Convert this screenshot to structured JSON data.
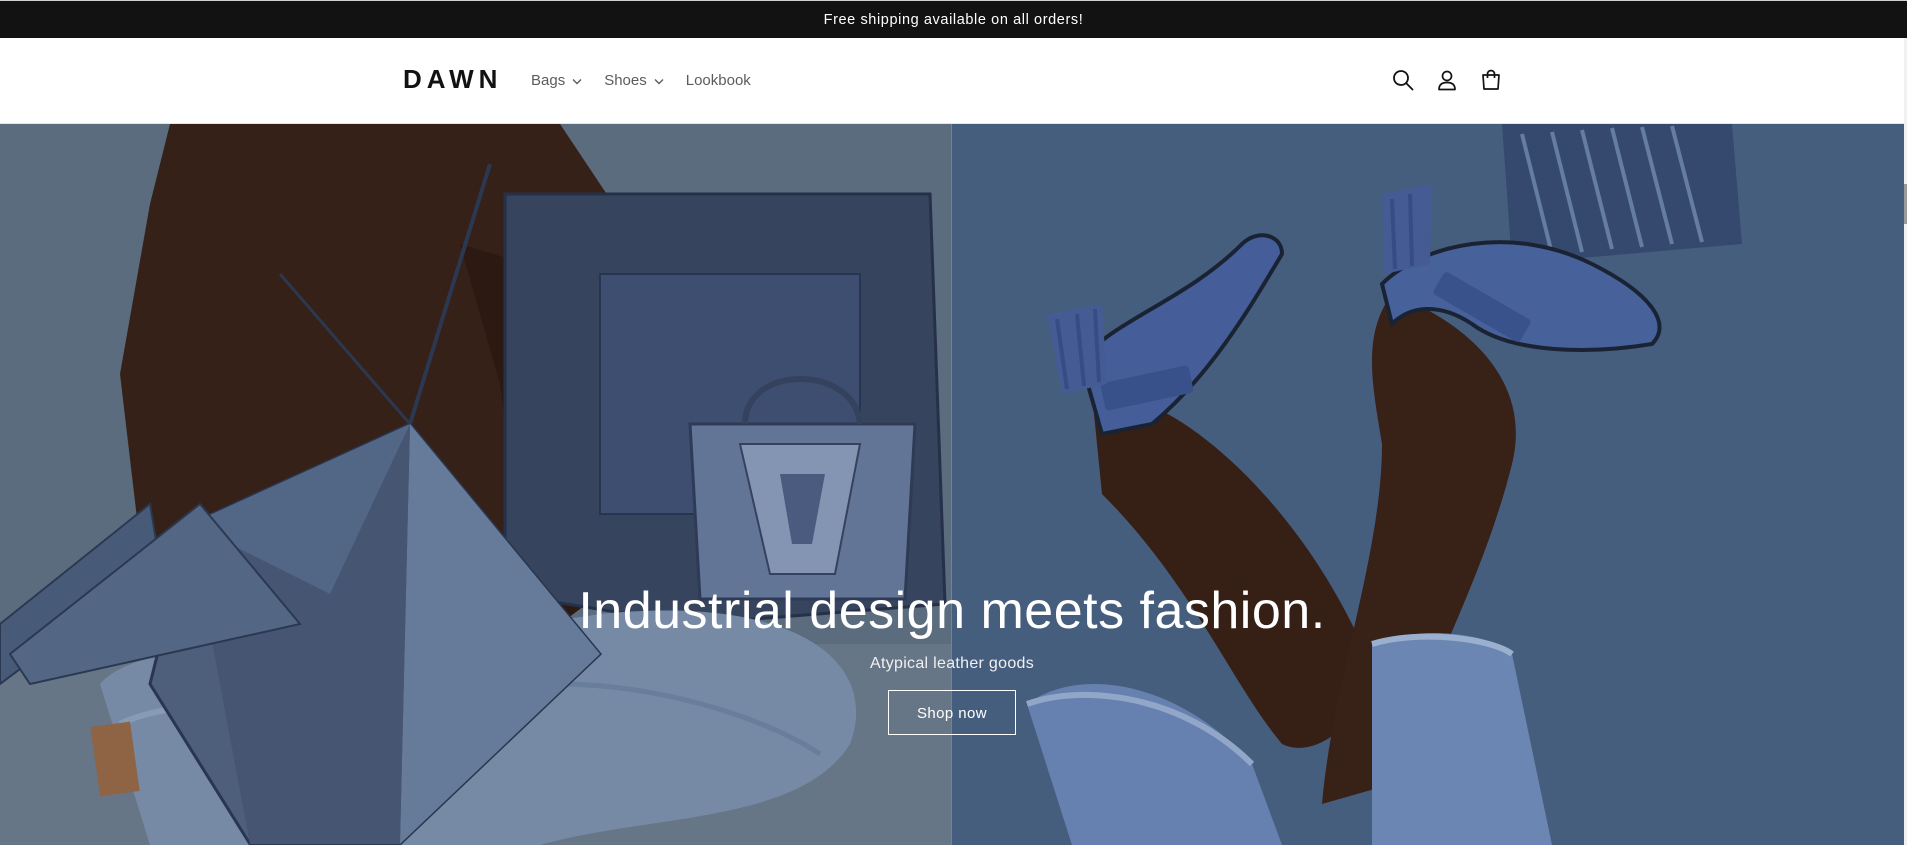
{
  "announcement": {
    "text": "Free shipping available on all orders!"
  },
  "header": {
    "logo": "DAWN",
    "nav": [
      {
        "label": "Bags",
        "has_dropdown": true
      },
      {
        "label": "Shoes",
        "has_dropdown": true
      },
      {
        "label": "Lookbook",
        "has_dropdown": false
      }
    ],
    "icons": [
      "search-icon",
      "account-icon",
      "cart-icon"
    ]
  },
  "hero": {
    "title": "Industrial design meets fashion.",
    "subtitle": "Atypical leather goods",
    "button_label": "Shop now",
    "images": [
      "model-with-geometric-bags",
      "legs-with-blue-heels"
    ]
  },
  "colors": {
    "announcement_bg": "#121212",
    "hero_left": "#5f7386",
    "hero_right": "#4d6689",
    "text_dark": "#121212"
  }
}
